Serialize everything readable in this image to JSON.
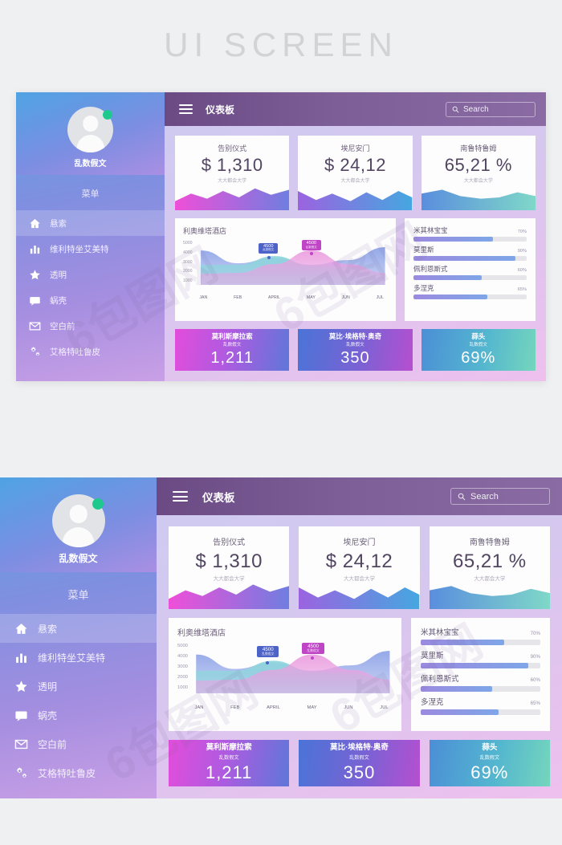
{
  "page": {
    "title": "UI SCREEN"
  },
  "sidebar": {
    "profile_name": "乱数假文",
    "menu_label": "菜单",
    "items": [
      {
        "label": "悬索",
        "icon": "home-icon",
        "active": true
      },
      {
        "label": "维利特坐艾美特",
        "icon": "bar-chart-icon",
        "active": false
      },
      {
        "label": "透明",
        "icon": "star-icon",
        "active": false
      },
      {
        "label": "蜗壳",
        "icon": "comment-icon",
        "active": false
      },
      {
        "label": "空白前",
        "icon": "envelope-icon",
        "active": false
      },
      {
        "label": "艾格特吐鲁皮",
        "icon": "gears-icon",
        "active": false
      }
    ]
  },
  "topbar": {
    "menu_icon": "hamburger-icon",
    "title": "仪表板",
    "search_placeholder": "Search",
    "search_icon": "search-icon"
  },
  "stat_cards": [
    {
      "title": "告别仪式",
      "value": "$ 1,310",
      "subtitle": "大大都会大学",
      "wave_from": "#ef4fd8",
      "wave_to": "#6f7ee0"
    },
    {
      "title": "埃尼安门",
      "value": "$ 24,12",
      "subtitle": "大大都会大学",
      "wave_from": "#9b63e0",
      "wave_to": "#45a7e0"
    },
    {
      "title": "南鲁特鲁姆",
      "value": "65,21 %",
      "subtitle": "大大都会大学",
      "wave_from": "#5a8ede",
      "wave_to": "#7fd8c8"
    }
  ],
  "chart_data": {
    "type": "area",
    "title": "利奥维塔酒店",
    "xlabel": "",
    "ylabel": "",
    "grid": false,
    "legend": "none",
    "ylim": [
      0,
      5000
    ],
    "yticks": [
      "5000",
      "4000",
      "3000",
      "2000",
      "1000"
    ],
    "categories": [
      "JAN",
      "FEB",
      "APRIL",
      "MAY",
      "JUN",
      "JUL"
    ],
    "series": [
      {
        "name": "series-blue",
        "values": [
          4300,
          2700,
          3400,
          2500,
          3100,
          4700
        ],
        "color": "#8fa4e8"
      },
      {
        "name": "series-teal",
        "values": [
          2500,
          2500,
          3600,
          2400,
          2200,
          1400
        ],
        "color": "#8ed6dc"
      },
      {
        "name": "series-pink",
        "values": [
          1400,
          1500,
          2600,
          4300,
          2600,
          1500
        ],
        "color": "#eba0e0"
      }
    ],
    "annotations": [
      {
        "label": "4500",
        "sublabel": "乱数假文",
        "series": "series-blue",
        "x": "FEB-APRIL",
        "value": 4500,
        "color": "#4e63c8"
      },
      {
        "label": "4500",
        "sublabel": "乱数假文",
        "series": "series-pink",
        "x": "MAY",
        "value": 4500,
        "color": "#bf45c6"
      }
    ]
  },
  "progress_panel": {
    "items": [
      {
        "name": "米其林宝宝",
        "percent": "70%",
        "value": 70
      },
      {
        "name": "莫里斯",
        "percent": "90%",
        "value": 90
      },
      {
        "name": "佩利恩斯式",
        "percent": "60%",
        "value": 60
      },
      {
        "name": "多涅克",
        "percent": "65%",
        "value": 65
      }
    ]
  },
  "bottom_tiles": [
    {
      "title": "莫利斯摩拉索",
      "subtitle": "乱数假文",
      "value": "1,211"
    },
    {
      "title": "莫比·埃格特·奥奇",
      "subtitle": "乱数假文",
      "value": "350"
    },
    {
      "title": "蒜头",
      "subtitle": "乱数假文",
      "value": "69%"
    }
  ]
}
